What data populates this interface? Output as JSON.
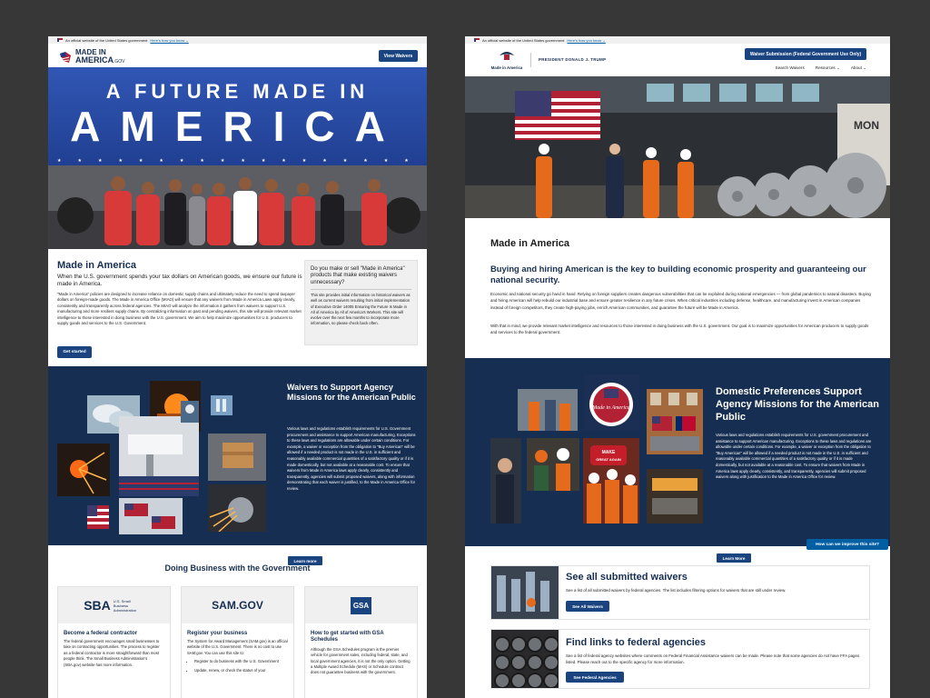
{
  "left": {
    "gov_banner": {
      "text": "An official website of the United States government",
      "link": "Here's how you know ⌄"
    },
    "logo": {
      "line1": "MADE IN",
      "line2": "AMERICA",
      "suffix": ".GOV"
    },
    "header_button": "View Waivers",
    "hero": {
      "line1": "A FUTURE MADE IN",
      "line2": "AMERICA"
    },
    "intro": {
      "title": "Made in America",
      "subtitle": "When the U.S. government spends your tax dollars on American goods, we ensure our future is made in America.",
      "body": "\"Made in America\" policies are designed to increase reliance on domestic supply chains and ultimately reduce the need to spend taxpayer dollars on foreign-made goods. The Made in America Office (MIAO) will ensure that any waivers from Made in America Laws apply clearly, consistently and transparently across federal agencies. The MIAO will analyze the information it gathers from waivers to support U.S. manufacturing and more resilient supply chains. By centralizing information on past and pending waivers, this site will provide relevant market intelligence to those interested in doing business with the U.S. government. We aim to help maximize opportunities for U.S. producers to supply goods and services to the U.S. Government.",
      "button": "Get started"
    },
    "aside": {
      "title": "Do you make or sell \"Made in America\" products that make existing waivers unnecessary?",
      "body": "This site provides initial information on historical waivers as well as current waivers resulting from initial implementation of Executive Order 14005 Ensuring the Future Is Made in All of America by All of America's Workers. This site will evolve over the next few months to incorporate more information, so please check back often."
    },
    "waivers": {
      "title": "Waivers to Support Agency Missions for the American Public",
      "body": "Various laws and regulations establish requirements for U.S. Government procurement and assistance to support American manufacturing. Exceptions to these laws and regulations are allowable under certain conditions. For example, a waiver or exception from the obligation to \"Buy American\" will be allowed if a needed product is not made in the U.S. in sufficient and reasonably available commercial quantities of a satisfactory quality or if it is made domestically, but not available at a reasonable cost. To ensure that waivers from Made in America laws apply clearly, consistently and transparently, agencies will submit proposed waivers, along with information demonstrating that each waiver is justified, to the Made in America Office for review.",
      "button": "Learn more"
    },
    "business": {
      "title": "Doing Business with the Government",
      "cards": [
        {
          "logo": "SBA",
          "logo_sub": "U.S. Small Business Administration",
          "title": "Become a federal contractor",
          "body": "The federal government encourages small businesses to take on contracting opportunities. The process to register as a federal contractor is more straightforward than most people think. The Small Business Administration's (SBA.gov) website has more information."
        },
        {
          "logo": "SAM.GOV",
          "title": "Register your business",
          "body": "The System for Award Management (SAM.gov) is an official website of the U.S. Government. There is no cost to use SAM.gov. You can use this site to:",
          "bullets": [
            "Register to do business with the U.S. Government",
            "Update, renew, or check the status of your"
          ]
        },
        {
          "logo": "GSA",
          "title": "How to get started with GSA Schedules",
          "body": "Although the GSA Schedules program is the premier vehicle for government sales, including federal, state, and local government agencies, it is not the only option. Getting a Multiple Award Schedule (MAS) or Schedule contract does not guarantee business with the government."
        }
      ]
    }
  },
  "right": {
    "gov_banner": {
      "text": "An official website of the United States government",
      "link": "Here's how you know ⌄"
    },
    "logo_text": "Made in America",
    "president": "PRESIDENT DONALD J. TRUMP",
    "header_button": "Waiver Submission (Federal Government Use Only)",
    "nav": [
      "Search Waivers",
      "Resources ⌄",
      "About ⌄"
    ],
    "intro": {
      "title": "Made in America",
      "subtitle": "Buying and hiring American is the key to building economic prosperity and guaranteeing our national security.",
      "p1": "Economic and national security go hand in hand. Relying on foreign suppliers creates dangerous vulnerabilities that can be exploited during national emergencies — from global pandemics to natural disasters. Buying and hiring American will help rebuild our industrial base and ensure greater resilience in any future crises. When critical industries including defense, healthcare, and manufacturing invest in American companies instead of foreign competitors, they create high-paying jobs, enrich American communities, and guarantee the future will be Made in America.",
      "p2": "With that in mind, we provide relevant market intelligence and resources to those interested in doing business with the U.S. government. Our goal is to maximize opportunities for American producers to supply goods and services to the federal government."
    },
    "badge_text": "Made in America",
    "hat_text": "MAKE AMERICA GREAT AGAIN",
    "domestic": {
      "title": "Domestic Preferences Support Agency Missions for the American Public",
      "body": "Various laws and regulations establish requirements for U.S. government procurement and assistance to support American manufacturing. Exceptions to these laws and regulations are allowable under certain conditions. For example, a waiver or exception from the obligation to \"Buy American\" will be allowed if a needed product is not made in the U.S. in sufficient and reasonably available commercial quantities of a satisfactory quality or if it is made domestically, but not available at a reasonable cost. To ensure that waivers from Made in America laws apply clearly, consistently, and transparently, agencies will submit proposed waivers along with justification to the Made in America Office for review.",
      "button": "Learn More",
      "feedback": "How can we improve this site?"
    },
    "cards": [
      {
        "title": "See all submitted waivers",
        "body": "See a list of all submitted waivers by federal agencies. The list includes filtering options for waivers that are still under review.",
        "button": "See All Waivers"
      },
      {
        "title": "Find links to federal agencies",
        "body": "See a list of federal agency websites where comments on Federal Financial Assistance waivers can be made. Please note that some agencies do not have FFA pages listed. Please reach out to the specific agency for more information.",
        "button": "See Federal Agencies"
      }
    ]
  },
  "colors": {
    "navy": "#162e51",
    "button": "#1a4480",
    "red": "#b22234",
    "hero_blue": "#1d3a8a"
  }
}
